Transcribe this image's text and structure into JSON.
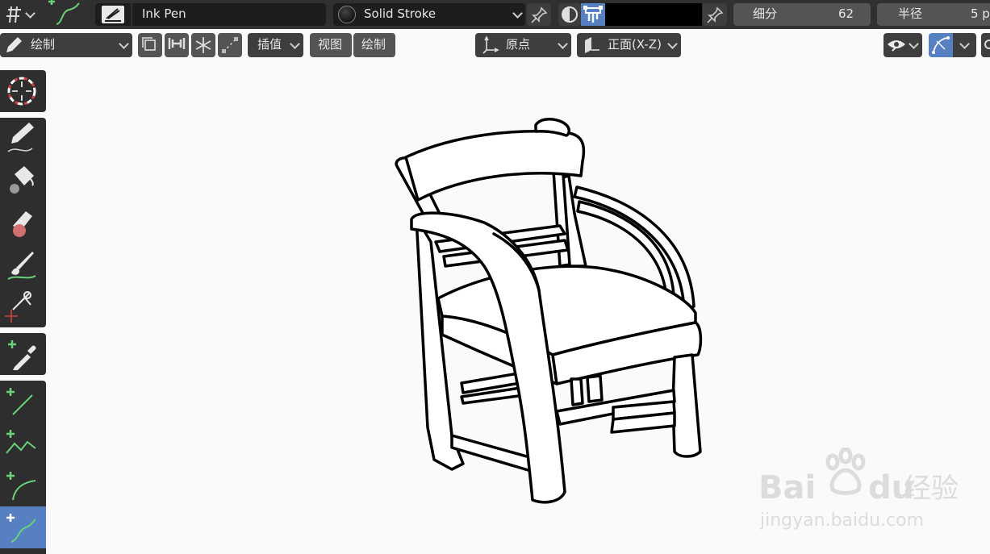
{
  "header": {
    "brush_name": "Ink Pen",
    "material_name": "Solid Stroke",
    "subdivision_label": "细分",
    "subdivision_value": "62",
    "radius_label": "半径",
    "radius_value": "5 p"
  },
  "toolbar": {
    "mode_label": "绘制",
    "interpolate_label": "插值",
    "view_label": "视图",
    "draw_label": "绘制",
    "origin_label": "原点",
    "orientation_label": "正面(X-Z)"
  },
  "tools": [
    "cursor-tool",
    "draw-tool",
    "fill-tool",
    "erase-tool",
    "tint-tool",
    "cutter-tool",
    "eyedropper-tool",
    "line-tool",
    "polyline-tool",
    "arc-tool",
    "curve-tool"
  ],
  "colors": {
    "accent": "#5680c2",
    "panel": "#303030",
    "canvas": "#fafafa",
    "plus": "#6ad27a"
  },
  "watermark": {
    "brand_left": "Bai",
    "brand_right": "du",
    "brand_cn": "经验",
    "url": "jingyan.baidu.com"
  }
}
